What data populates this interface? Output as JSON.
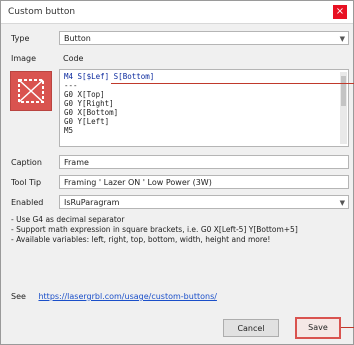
{
  "dialog": {
    "title": "Custom button",
    "close_glyph": "×"
  },
  "form": {
    "type_label": "Type",
    "type_value": "Button",
    "image_label": "Image",
    "image_value": "Code",
    "caption_label": "Caption",
    "caption_value": "Frame",
    "tooltip_label": "Tool Tip",
    "tooltip_value": "Framing ' Lazer ON ' Low Power (3W)",
    "enabled_label": "Enabled",
    "enabled_value": "IsRuParagram"
  },
  "script": {
    "lines": [
      "M4 S[$Lef] S[Bottom]",
      "---",
      "G0 X[Top]",
      "G0 Y[Right]",
      "G0 X[Bottom]",
      "G0 Y[Left]",
      "M5"
    ]
  },
  "notes": [
    "- Use G4 as decimal separator",
    "- Support math expression in square brackets, i.e. G0 X[Left-5] Y[Bottom+5]",
    "- Available variables: left, right, top, bottom, width, height and more!"
  ],
  "see_label": "See",
  "see_link": "https://lasergrbl.com/usage/custom-buttons/",
  "buttons": {
    "cancel": "Cancel",
    "save": "Save"
  },
  "colors": {
    "accent_red": "#d9534f",
    "link": "#1a4fc9"
  }
}
